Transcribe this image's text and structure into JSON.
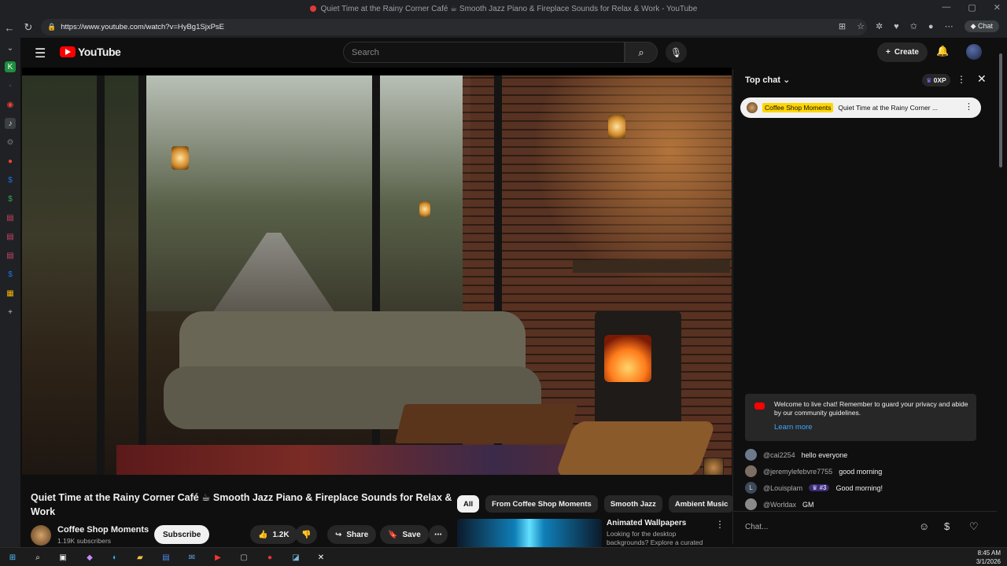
{
  "browser": {
    "window_title": "Quiet Time at the Rainy Corner Café ☕ Smooth Jazz Piano & Fireplace Sounds for Relax & Work - YouTube",
    "url": "https://www.youtube.com/watch?v=HyBg1SjxPsE",
    "chat_label": "Chat"
  },
  "header": {
    "logo_text": "YouTube",
    "search_placeholder": "Search",
    "create_label": "Create"
  },
  "video": {
    "title": "Quiet Time at the Rainy Corner Café ☕ Smooth Jazz Piano & Fireplace Sounds for Relax & Work",
    "channel_name": "Coffee Shop Moments",
    "subscribers": "1.19K subscribers",
    "subscribe_label": "Subscribe",
    "likes": "1.2K",
    "share_label": "Share",
    "save_label": "Save"
  },
  "chips": [
    "All",
    "From Coffee Shop Moments",
    "Smooth Jazz",
    "Ambient Music"
  ],
  "recommendation": {
    "title": "Animated Wallpapers",
    "description": "Looking for the desktop backgrounds? Explore a curated"
  },
  "chat": {
    "header": "Top chat",
    "xp": "0XP",
    "pinned_author": "Coffee Shop Moments",
    "pinned_text": "Quiet Time at the Rainy Corner ...",
    "welcome_text": "Welcome to live chat! Remember to guard your privacy and abide by our community guidelines.",
    "learn_more": "Learn more",
    "messages": [
      {
        "author": "@cai2254",
        "text": "hello everyone",
        "badge": ""
      },
      {
        "author": "@jeremylefebvre7755",
        "text": "good morning",
        "badge": ""
      },
      {
        "author": "@Louisplam",
        "text": "Good morning!",
        "badge": "#3",
        "initial": "L"
      },
      {
        "author": "@Worldax",
        "text": "GM",
        "badge": ""
      }
    ],
    "input_placeholder": "Chat..."
  },
  "taskbar": {
    "time": "8:45 AM",
    "date": "3/1/2026"
  },
  "colors": {
    "youtube_red": "#ff0000",
    "link_blue": "#3ea6ff",
    "pinned_highlight": "#ffd600",
    "background": "#0f0f0f"
  }
}
